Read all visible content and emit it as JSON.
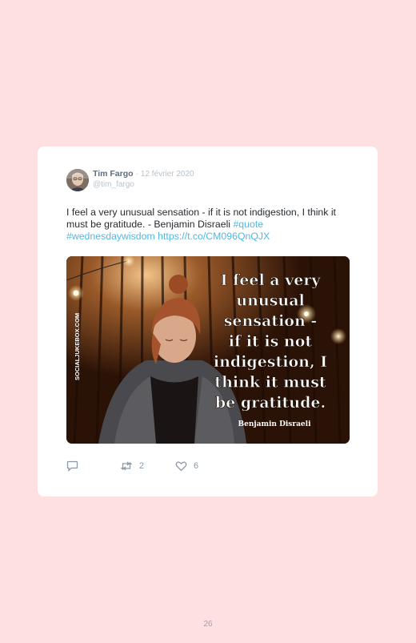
{
  "tweet": {
    "author_name": "Tim Fargo",
    "separator": "·",
    "date": "12 février 2020",
    "handle": "@tim_fargo",
    "text_plain": "I feel a very unusual sensation - if it is not indigestion, I think it must be gratitude. - Benjamin Disraeli",
    "hashtag_quote": "#quote",
    "hashtag_wednesday": "#wednesdaywisdom",
    "url": "https://t.co/CM096QnQJX"
  },
  "media": {
    "watermark": "SOCIALJUKEBOX.COM",
    "quote_lines": [
      "I feel a very",
      "unusual",
      "sensation -",
      "if it is not",
      "indigestion, I",
      "think it must",
      "be gratitude."
    ],
    "quote_author": "Benjamin Disraeli"
  },
  "actions": {
    "reply_icon": "speech-bubble-icon",
    "retweet_icon": "retweet-icon",
    "retweet_count": "2",
    "like_icon": "heart-icon",
    "like_count": "6"
  },
  "page": {
    "number": "26"
  },
  "colors": {
    "background": "#fde0df",
    "link": "#54b6e3",
    "name": "#5b6e80",
    "muted": "#b9c3cc",
    "action": "#8b98a5"
  }
}
